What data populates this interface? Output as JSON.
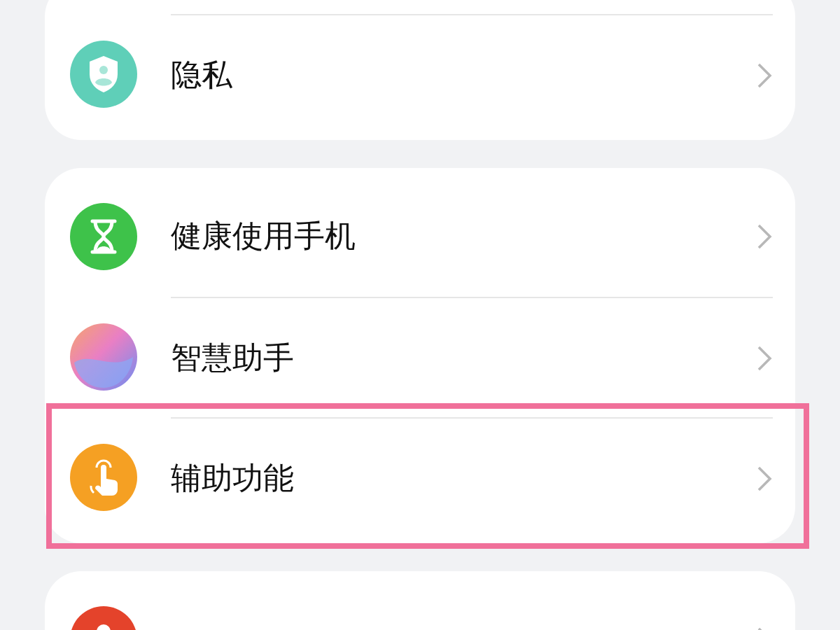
{
  "sections": [
    {
      "items": [
        {
          "label": "隐私",
          "kind": "shield",
          "highlighted": false
        }
      ]
    },
    {
      "items": [
        {
          "label": "健康使用手机",
          "kind": "hourglass",
          "highlighted": false
        },
        {
          "label": "智慧助手",
          "kind": "orb",
          "highlighted": false
        },
        {
          "label": "辅助功能",
          "kind": "hand",
          "highlighted": true
        }
      ]
    },
    {
      "items": [
        {
          "kind": "user",
          "highlighted": false
        }
      ]
    }
  ]
}
